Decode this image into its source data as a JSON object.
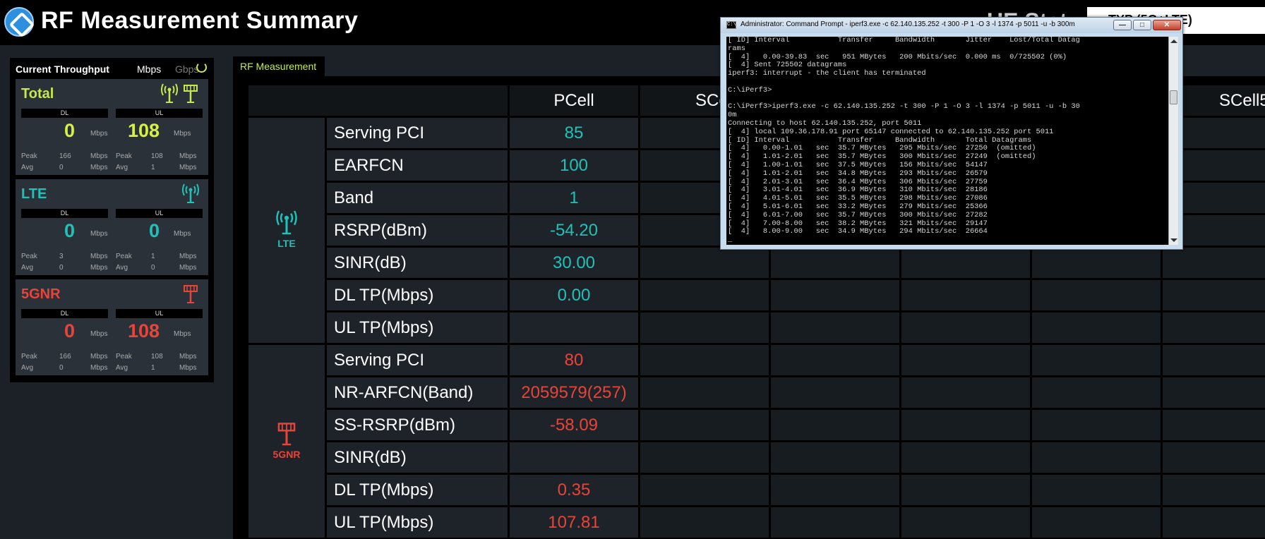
{
  "header": {
    "title": "RF Measurement Summary",
    "ue_status_label": "UE Stat",
    "rat_label": "TYP (5G+LTE)"
  },
  "throughput": {
    "title": "Current Throughput",
    "unit_mbps": "Mbps",
    "unit_gbps": "Gbps",
    "dl_label": "DL",
    "ul_label": "UL",
    "unit": "Mbps",
    "peak_label": "Peak",
    "avg_label": "Avg",
    "cards": [
      {
        "name": "Total",
        "color": "#c9e84c",
        "dl": "0",
        "ul": "108",
        "dl_peak": "166",
        "dl_avg": "0",
        "ul_peak": "108",
        "ul_avg": "1",
        "icons": [
          "lte-tower-icon",
          "5g-tower-icon"
        ]
      },
      {
        "name": "LTE",
        "color": "#1fc2b8",
        "dl": "0",
        "ul": "0",
        "dl_peak": "3",
        "dl_avg": "0",
        "ul_peak": "1",
        "ul_avg": "0",
        "icons": [
          "lte-tower-icon"
        ]
      },
      {
        "name": "5GNR",
        "color": "#e8443a",
        "dl": "0",
        "ul": "108",
        "dl_peak": "166",
        "dl_avg": "0",
        "ul_peak": "108",
        "ul_avg": "1",
        "icons": [
          "5g-tower-icon"
        ]
      }
    ],
    "total_value_color": "#d7f13e"
  },
  "rf": {
    "tab_label": "RF Measurement",
    "columns": [
      "PCell",
      "SCell",
      "SCell5"
    ],
    "groups": [
      {
        "name": "LTE",
        "color": "#1fc2b8",
        "rows": [
          {
            "label": "Serving PCI",
            "value": "85"
          },
          {
            "label": "EARFCN",
            "value": "100"
          },
          {
            "label": "Band",
            "value": "1"
          },
          {
            "label": "RSRP(dBm)",
            "value": "-54.20"
          },
          {
            "label": "SINR(dB)",
            "value": "30.00"
          },
          {
            "label": "DL TP(Mbps)",
            "value": "0.00"
          },
          {
            "label": "UL TP(Mbps)",
            "value": ""
          }
        ]
      },
      {
        "name": "5GNR",
        "color": "#e8443a",
        "rows": [
          {
            "label": "Serving PCI",
            "value": "80"
          },
          {
            "label": "NR-ARFCN(Band)",
            "value": "2059579(257)"
          },
          {
            "label": "SS-RSRP(dBm)",
            "value": "-58.09"
          },
          {
            "label": "SINR(dB)",
            "value": ""
          },
          {
            "label": "DL TP(Mbps)",
            "value": "0.35"
          },
          {
            "label": "UL TP(Mbps)",
            "value": "107.81"
          }
        ]
      }
    ]
  },
  "terminal": {
    "title": "Administrator: Command Prompt - iperf3.exe  -c 62.140.135.252 -t 300 -P 1 -O 3 -l 1374 -p 5011 -u -b 300m",
    "minimize": "—",
    "maximize": "□",
    "close": "✕",
    "lines": [
      "[ ID] Interval           Transfer     Bandwidth       Jitter    Lost/Total Datag",
      "rams",
      "[  4]   0.00-39.83  sec   951 MBytes   200 Mbits/sec  0.000 ms  0/725502 (0%)",
      "[  4] Sent 725502 datagrams",
      "iperf3: interrupt - the client has terminated",
      "",
      "C:\\iPerf3>",
      "",
      "C:\\iPerf3>iperf3.exe -c 62.140.135.252 -t 300 -P 1 -O 3 -l 1374 -p 5011 -u -b 30",
      "0m",
      "Connecting to host 62.140.135.252, port 5011",
      "[  4] local 109.36.178.91 port 65147 connected to 62.140.135.252 port 5011",
      "[ ID] Interval           Transfer     Bandwidth       Total Datagrams",
      "[  4]   0.00-1.01   sec  35.7 MBytes   295 Mbits/sec  27250  (omitted)",
      "[  4]   1.01-2.01   sec  35.7 MBytes   300 Mbits/sec  27249  (omitted)",
      "[  4]   1.00-1.01   sec  37.5 MBytes   156 Mbits/sec  54147",
      "[  4]   1.01-2.01   sec  34.8 MBytes   293 Mbits/sec  26579",
      "[  4]   2.01-3.01   sec  36.4 MBytes   306 Mbits/sec  27759",
      "[  4]   3.01-4.01   sec  36.9 MBytes   310 Mbits/sec  28186",
      "[  4]   4.01-5.01   sec  35.5 MBytes   298 Mbits/sec  27086",
      "[  4]   5.01-6.01   sec  33.2 MBytes   279 Mbits/sec  25366",
      "[  4]   6.01-7.00   sec  35.7 MBytes   300 Mbits/sec  27282",
      "[  4]   7.00-8.00   sec  38.2 MBytes   321 Mbits/sec  29147",
      "[  4]   8.00-9.00   sec  34.9 MBytes   294 Mbits/sec  26664",
      "_"
    ]
  }
}
